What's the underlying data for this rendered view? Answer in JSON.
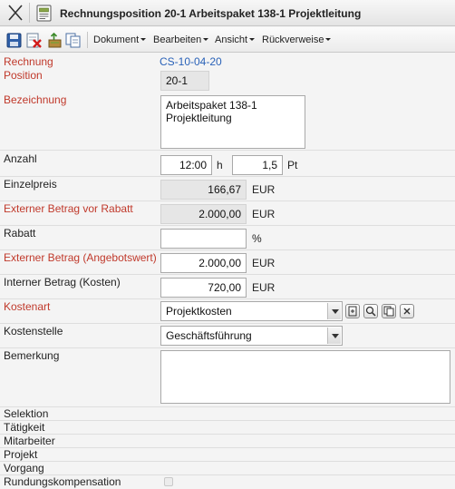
{
  "window": {
    "title": "Rechnungsposition 20-1 Arbeitspaket 138-1 Projektleitung",
    "close_icon": "close-icon",
    "doc_icon": "document-icon"
  },
  "toolbar": {
    "icons": [
      "save-icon",
      "delete-icon",
      "export-icon",
      "copy-icon"
    ],
    "menus": [
      "Dokument",
      "Bearbeiten",
      "Ansicht",
      "Rückverweise"
    ]
  },
  "form": {
    "rechnung": {
      "label": "Rechnung",
      "value": "CS-10-04-20"
    },
    "position": {
      "label": "Position",
      "value": "20-1"
    },
    "bezeichnung": {
      "label": "Bezeichnung",
      "value": "Arbeitspaket 138-1 Projektleitung"
    },
    "anzahl": {
      "label": "Anzahl",
      "value": "12:00",
      "unit": "h",
      "value2": "1,5",
      "unit2": "Pt"
    },
    "einzelpreis": {
      "label": "Einzelpreis",
      "value": "166,67",
      "unit": "EUR"
    },
    "ext_vor_rabatt": {
      "label": "Externer Betrag vor Rabatt",
      "value": "2.000,00",
      "unit": "EUR"
    },
    "rabatt": {
      "label": "Rabatt",
      "value": "",
      "unit": "%"
    },
    "ext_betrag": {
      "label": "Externer Betrag (Angebotswert)",
      "value": "2.000,00",
      "unit": "EUR"
    },
    "int_betrag": {
      "label": "Interner Betrag (Kosten)",
      "value": "720,00",
      "unit": "EUR"
    },
    "kostenart": {
      "label": "Kostenart",
      "value": "Projektkosten",
      "buttons": [
        "edit-icon",
        "search-icon",
        "copy-icon",
        "clear-icon"
      ]
    },
    "kostenstelle": {
      "label": "Kostenstelle",
      "value": "Geschäftsführung"
    },
    "bemerkung": {
      "label": "Bemerkung",
      "value": ""
    },
    "selektion": {
      "label": "Selektion"
    },
    "taetigkeit": {
      "label": "Tätigkeit"
    },
    "mitarbeiter": {
      "label": "Mitarbeiter"
    },
    "projekt": {
      "label": "Projekt"
    },
    "vorgang": {
      "label": "Vorgang"
    },
    "rundung": {
      "label": "Rundungskompensation"
    }
  },
  "colors": {
    "required_label": "#c0392b",
    "link": "#2a62b8",
    "accent": "#1a4f9c"
  }
}
